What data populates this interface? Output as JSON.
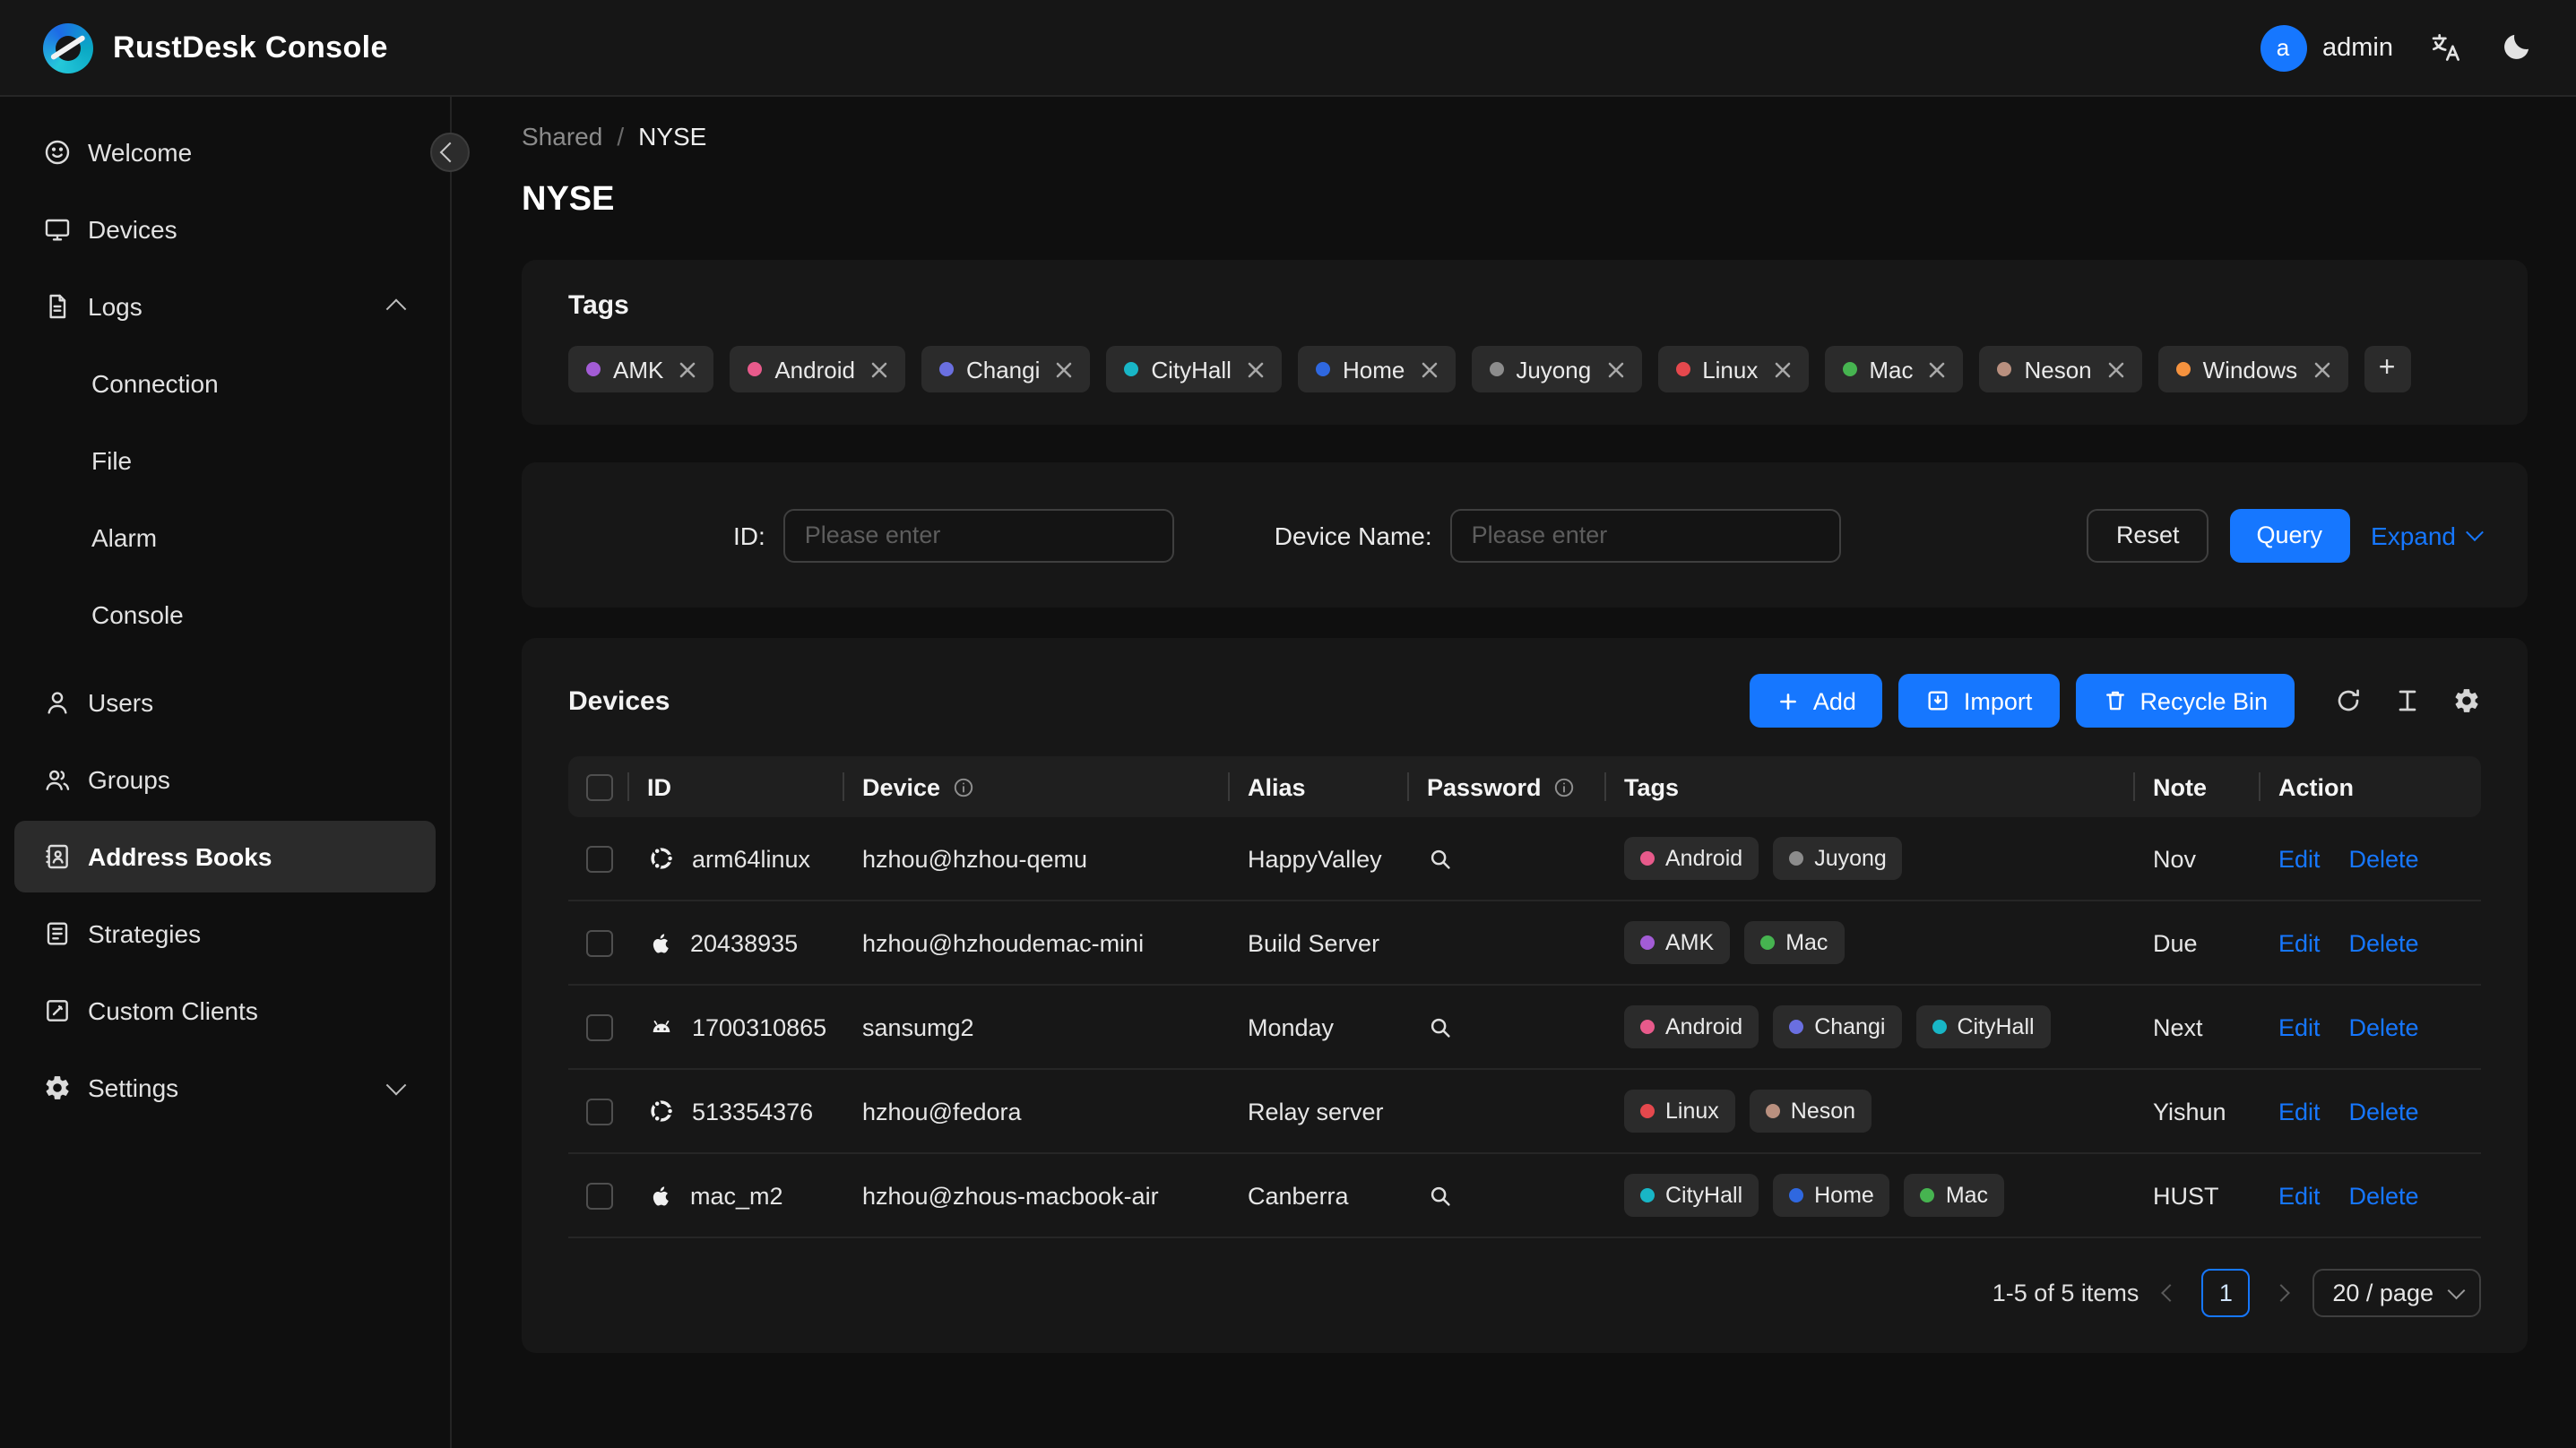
{
  "header": {
    "app_title": "RustDesk Console",
    "user": {
      "avatar_letter": "a",
      "name": "admin"
    }
  },
  "sidebar": {
    "items": [
      {
        "label": "Welcome"
      },
      {
        "label": "Devices"
      },
      {
        "label": "Logs"
      },
      {
        "label": "Connection"
      },
      {
        "label": "File"
      },
      {
        "label": "Alarm"
      },
      {
        "label": "Console"
      },
      {
        "label": "Users"
      },
      {
        "label": "Groups"
      },
      {
        "label": "Address Books"
      },
      {
        "label": "Strategies"
      },
      {
        "label": "Custom Clients"
      },
      {
        "label": "Settings"
      }
    ]
  },
  "breadcrumb": {
    "parent": "Shared",
    "separator": "/",
    "current": "NYSE"
  },
  "page": {
    "title": "NYSE"
  },
  "tags_card": {
    "title": "Tags",
    "add_label": "+",
    "tags": [
      {
        "label": "AMK",
        "color": "#a35cd6"
      },
      {
        "label": "Android",
        "color": "#e85a8b"
      },
      {
        "label": "Changi",
        "color": "#6a6fe0"
      },
      {
        "label": "CityHall",
        "color": "#18b6c6"
      },
      {
        "label": "Home",
        "color": "#2f68e0"
      },
      {
        "label": "Juyong",
        "color": "#8c8c8c"
      },
      {
        "label": "Linux",
        "color": "#e5484d"
      },
      {
        "label": "Mac",
        "color": "#46b450"
      },
      {
        "label": "Neson",
        "color": "#b9907f"
      },
      {
        "label": "Windows",
        "color": "#f5923e"
      }
    ]
  },
  "filter": {
    "id_label": "ID:",
    "id_placeholder": "Please enter",
    "device_label": "Device Name:",
    "device_placeholder": "Please enter",
    "reset": "Reset",
    "query": "Query",
    "expand": "Expand"
  },
  "devices": {
    "title": "Devices",
    "add": "Add",
    "import": "Import",
    "recycle_bin": "Recycle Bin",
    "columns": {
      "id": "ID",
      "device": "Device",
      "alias": "Alias",
      "password": "Password",
      "tags": "Tags",
      "note": "Note",
      "action": "Action"
    },
    "rows": [
      {
        "os": "ubuntu",
        "id": "arm64linux",
        "device": "hzhou@hzhou-qemu",
        "alias": "HappyValley",
        "password_view": true,
        "tags": [
          {
            "label": "Android",
            "color": "#e85a8b"
          },
          {
            "label": "Juyong",
            "color": "#8c8c8c"
          }
        ],
        "note": "Nov",
        "edit": "Edit",
        "delete": "Delete"
      },
      {
        "os": "apple",
        "id": "20438935",
        "device": "hzhou@hzhoudemac-mini",
        "alias": "Build Server",
        "password_view": false,
        "tags": [
          {
            "label": "AMK",
            "color": "#a35cd6"
          },
          {
            "label": "Mac",
            "color": "#46b450"
          }
        ],
        "note": "Due",
        "edit": "Edit",
        "delete": "Delete"
      },
      {
        "os": "android",
        "id": "1700310865",
        "device": "sansumg2",
        "alias": "Monday",
        "password_view": true,
        "tags": [
          {
            "label": "Android",
            "color": "#e85a8b"
          },
          {
            "label": "Changi",
            "color": "#6a6fe0"
          },
          {
            "label": "CityHall",
            "color": "#18b6c6"
          }
        ],
        "note": "Next",
        "edit": "Edit",
        "delete": "Delete"
      },
      {
        "os": "ubuntu",
        "id": "513354376",
        "device": "hzhou@fedora",
        "alias": "Relay server",
        "password_view": false,
        "tags": [
          {
            "label": "Linux",
            "color": "#e5484d"
          },
          {
            "label": "Neson",
            "color": "#b9907f"
          }
        ],
        "note": "Yishun",
        "edit": "Edit",
        "delete": "Delete"
      },
      {
        "os": "apple",
        "id": "mac_m2",
        "device": "hzhou@zhous-macbook-air",
        "alias": "Canberra",
        "password_view": true,
        "tags": [
          {
            "label": "CityHall",
            "color": "#18b6c6"
          },
          {
            "label": "Home",
            "color": "#2f68e0"
          },
          {
            "label": "Mac",
            "color": "#46b450"
          }
        ],
        "note": "HUST",
        "edit": "Edit",
        "delete": "Delete"
      }
    ],
    "pagination": {
      "total": "1-5 of 5 items",
      "current_page": "1",
      "page_size": "20 / page"
    }
  },
  "colors": {
    "accent": "#1677ff"
  }
}
